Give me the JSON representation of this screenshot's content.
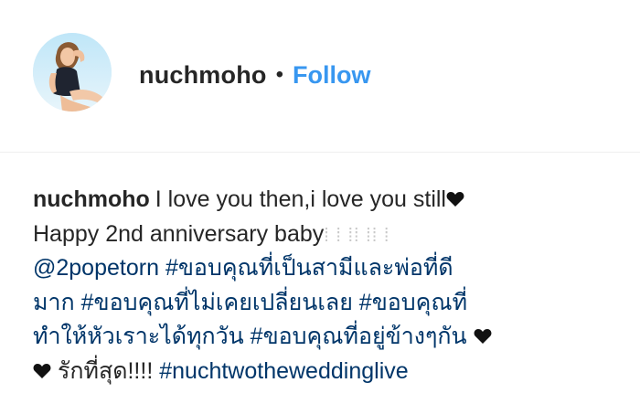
{
  "header": {
    "username": "nuchmoho",
    "separator": "•",
    "follow_label": "Follow"
  },
  "caption": {
    "username": "nuchmoho",
    "line1_text": "I love you then,i love you still",
    "line2_text": "Happy 2nd anniversary baby",
    "line2_glyphs": "⁞ ⁞ ⁞⁞ ⁞⁞ ⁞",
    "mention": "@2popetorn",
    "tag1": "#ขอบคุณที่เป็นสามีและพ่อที่ดี",
    "tag1_cont": "มาก",
    "tag2": "#ขอบคุณที่ไม่เคยเปลี่ยนเลย",
    "tag3": "#ขอบคุณที่",
    "tag3_cont": "ทำให้หัวเราะได้ทุกวัน",
    "tag4": "#ขอบคุณที่อยู่ข้างๆกัน",
    "line5_text": "รักที่สุด!!!!",
    "tag5": "#nuchtwotheweddinglive"
  },
  "icons": {
    "heart": "heart-icon",
    "avatar": "profile-photo"
  },
  "colors": {
    "link_blue": "#003569",
    "follow_blue": "#3897f0",
    "text": "#262626"
  }
}
